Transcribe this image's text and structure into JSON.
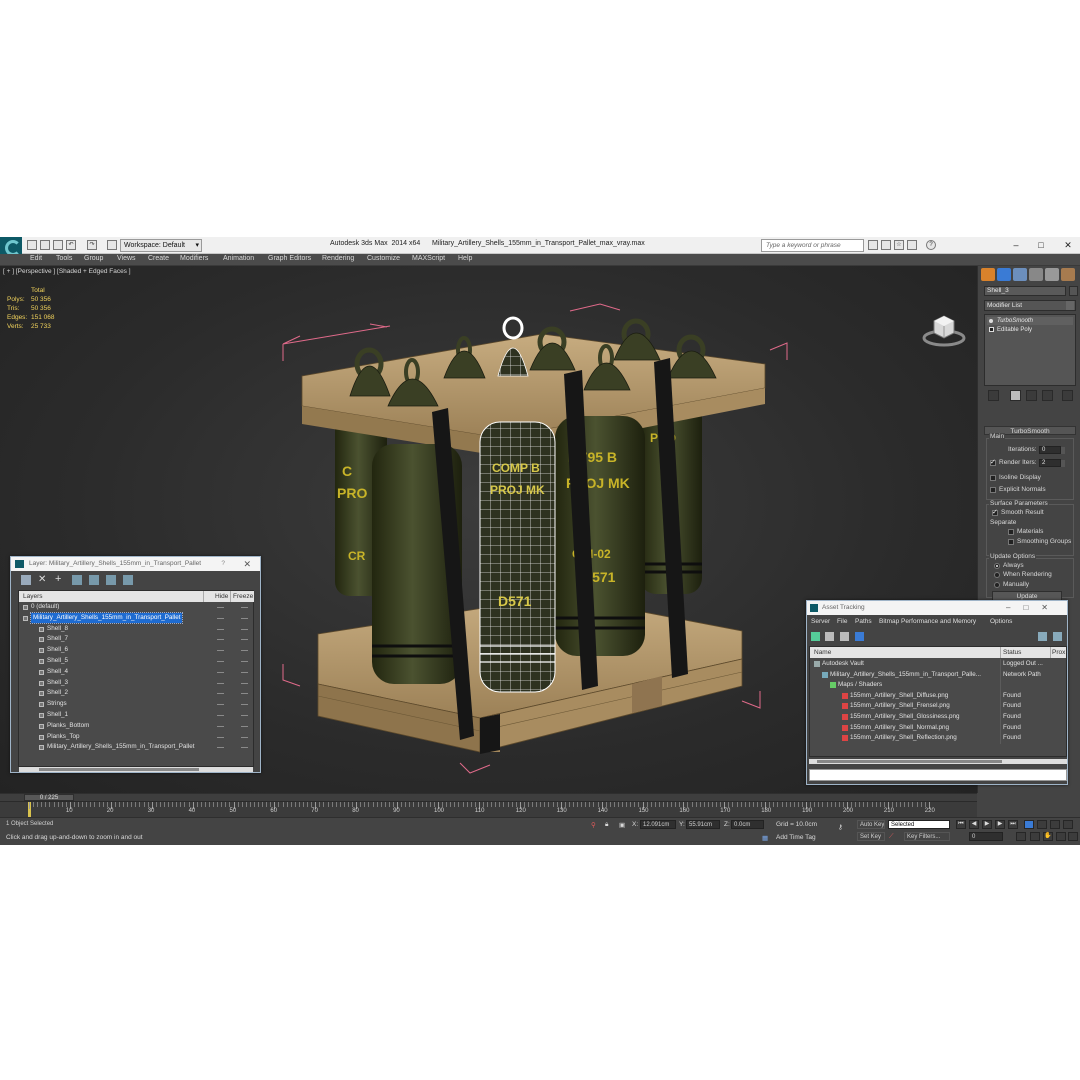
{
  "titlebar": {
    "workspace_label": "Workspace: Default",
    "app_title": "Autodesk 3ds Max  2014 x64      Military_Artillery_Shells_155mm_in_Transport_Pallet_max_vray.max",
    "search_placeholder": "Type a keyword or phrase"
  },
  "menu": [
    "Edit",
    "Tools",
    "Group",
    "Views",
    "Create",
    "Modifiers",
    "Animation",
    "Graph Editors",
    "Rendering",
    "Customize",
    "MAXScript",
    "Help"
  ],
  "viewport": {
    "label": "[ + ] [Perspective ] [Shaded + Edged Faces ]",
    "stats_header": "Total",
    "stats": [
      {
        "label": "Polys:",
        "value": "50 356"
      },
      {
        "label": "Tris:",
        "value": "50 356"
      },
      {
        "label": "Edges:",
        "value": "151 068"
      },
      {
        "label": "Verts:",
        "value": "25 733"
      }
    ]
  },
  "command_panel": {
    "object_name": "Shell_3",
    "modifier_list": "Modifier List",
    "stack": [
      "TurboSmooth",
      "Editable Poly"
    ],
    "rollout_title": "TurboSmooth",
    "main_group": "Main",
    "iterations_label": "Iterations:",
    "iterations_value": "0",
    "render_iters_label": "Render Iters:",
    "render_iters_value": "2",
    "isoline_label": "Isoline Display",
    "explicit_normals_label": "Explicit Normals",
    "surface_params_group": "Surface Parameters",
    "smooth_result_label": "Smooth Result",
    "separate_label": "Separate",
    "materials_label": "Materials",
    "smoothing_groups_label": "Smoothing Groups",
    "update_options_group": "Update Options",
    "always_label": "Always",
    "when_rendering_label": "When Rendering",
    "manually_label": "Manually",
    "update_button": "Update"
  },
  "timeline": {
    "frame_display": "0 / 225",
    "ticks": [
      "0",
      "10",
      "20",
      "30",
      "40",
      "50",
      "60",
      "70",
      "80",
      "90",
      "100",
      "110",
      "120",
      "130",
      "140",
      "150",
      "160",
      "170",
      "180",
      "190",
      "200",
      "210",
      "220"
    ]
  },
  "status": {
    "selection": "1 Object Selected",
    "prompt": "Click and drag up-and-down to zoom in and out",
    "x_label": "X:",
    "x_value": "12.091cm",
    "y_label": "Y:",
    "y_value": "55.91cm",
    "z_label": "Z:",
    "z_value": "0.0cm",
    "grid": "Grid = 10.0cm",
    "add_time_tag": "Add Time Tag",
    "auto_key": "Auto Key",
    "auto_key_value": "Selected",
    "set_key": "Set Key",
    "key_filters": "Key Filters...",
    "current_frame": "0"
  },
  "layer_dialog": {
    "title": "Layer: Military_Artillery_Shells_155mm_in_Transport_Pallet",
    "help": "?",
    "col_layers": "Layers",
    "col_hide": "Hide",
    "col_freeze": "Freeze",
    "rows": [
      {
        "name": "0 (default)"
      },
      {
        "name": "Military_Artillery_Shells_155mm_in_Transport_Pallet"
      },
      {
        "name": "Shell_8"
      },
      {
        "name": "Shell_7"
      },
      {
        "name": "Shell_6"
      },
      {
        "name": "Shell_5"
      },
      {
        "name": "Shell_4"
      },
      {
        "name": "Shell_3"
      },
      {
        "name": "Shell_2"
      },
      {
        "name": "Strings"
      },
      {
        "name": "Shell_1"
      },
      {
        "name": "Planks_Bottom"
      },
      {
        "name": "Planks_Top"
      },
      {
        "name": "Military_Artillery_Shells_155mm_in_Transport_Pallet"
      }
    ]
  },
  "asset_dialog": {
    "title": "Asset Tracking",
    "menu": [
      "Server",
      "File",
      "Paths",
      "Bitmap Performance and Memory",
      "Options"
    ],
    "col_name": "Name",
    "col_status": "Status",
    "col_proxy": "Prox",
    "rows": [
      {
        "name": "Autodesk Vault",
        "status": "Logged Out ..."
      },
      {
        "name": "Military_Artillery_Shells_155mm_in_Transport_Palle...",
        "status": "Network Path"
      },
      {
        "name": "Maps / Shaders",
        "status": ""
      },
      {
        "name": "155mm_Artillery_Shell_Diffuse.png",
        "status": "Found"
      },
      {
        "name": "155mm_Artillery_Shell_Frensel.png",
        "status": "Found"
      },
      {
        "name": "155mm_Artillery_Shell_Glossiness.png",
        "status": "Found"
      },
      {
        "name": "155mm_Artillery_Shell_Normal.png",
        "status": "Found"
      },
      {
        "name": "155mm_Artillery_Shell_Reflection.png",
        "status": "Found"
      }
    ]
  },
  "colors": {
    "app_bg": "#444444",
    "viewport_bg": "#2b2b2b",
    "stats_text": "#f2d35c",
    "selection_blue": "#1e6bd0",
    "shell_green": "#3c4228",
    "shell_text": "#c8b428",
    "wood": "#b39a72",
    "strap": "#161616",
    "bbox": "#e06a8a"
  }
}
